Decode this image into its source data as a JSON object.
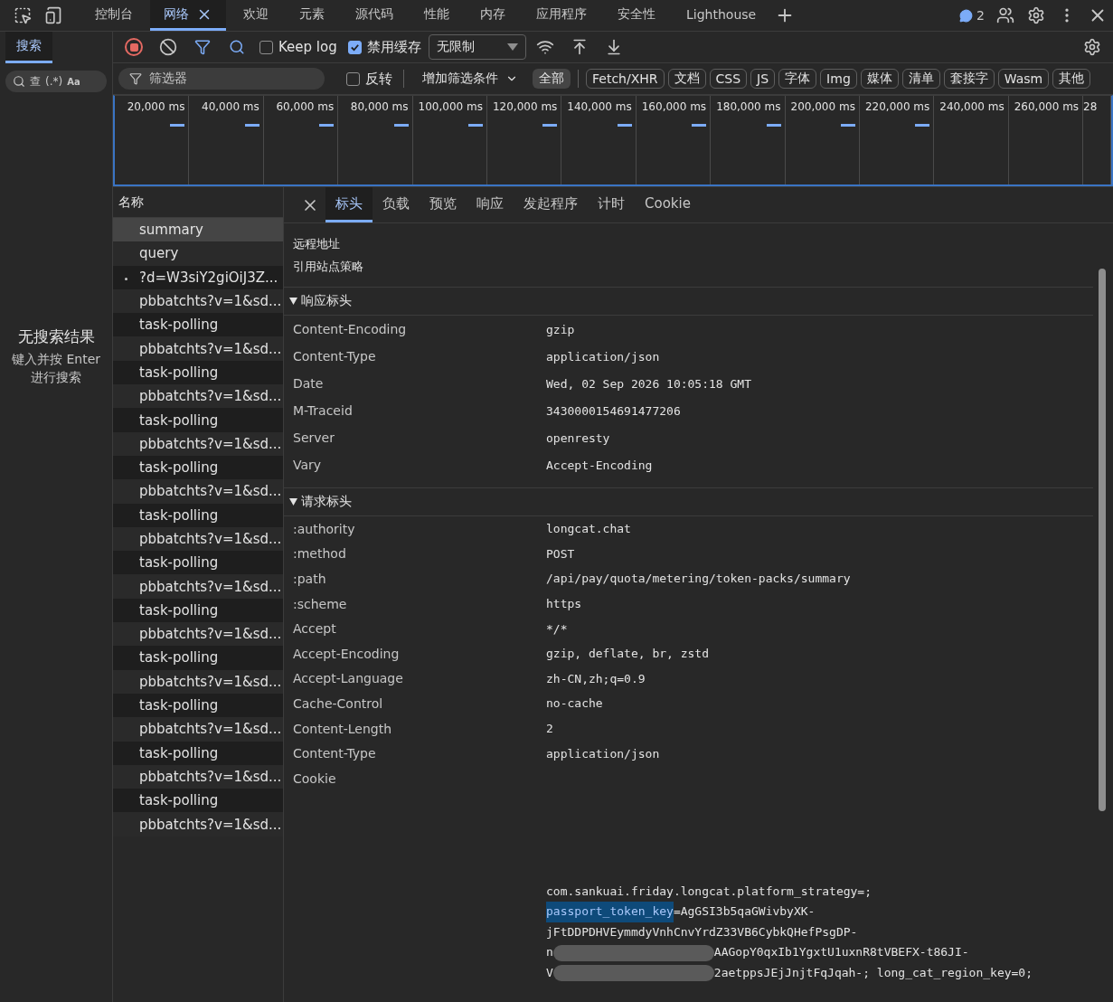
{
  "top_tabs": [
    {
      "label": "控制台",
      "selected": false,
      "closable": false
    },
    {
      "label": "网络",
      "selected": true,
      "closable": true
    },
    {
      "label": "欢迎",
      "selected": false,
      "closable": false
    },
    {
      "label": "元素",
      "selected": false,
      "closable": false
    },
    {
      "label": "源代码",
      "selected": false,
      "closable": false
    },
    {
      "label": "性能",
      "selected": false,
      "closable": false
    },
    {
      "label": "内存",
      "selected": false,
      "closable": false
    },
    {
      "label": "应用程序",
      "selected": false,
      "closable": false
    },
    {
      "label": "安全性",
      "selected": false,
      "closable": false
    },
    {
      "label": "Lighthouse",
      "selected": false,
      "closable": false
    }
  ],
  "issues_count": "2",
  "sidebar": {
    "tab": "搜索",
    "search_placeholder": "查",
    "regex_toggle": "(.*)",
    "case_toggle": "Aa",
    "empty_title": "无搜索结果",
    "empty_hint": "键入并按 Enter 进行搜索"
  },
  "toolbar": {
    "recording": true,
    "keep_log": {
      "label": "Keep log",
      "checked": false
    },
    "disable_cache": {
      "label": "禁用缓存",
      "checked": true
    },
    "throttle": "无限制"
  },
  "filter": {
    "placeholder": "筛选器",
    "invert": {
      "label": "反转",
      "checked": false
    },
    "more_filters": "增加筛选条件",
    "types": [
      {
        "label": "全部",
        "selected": true
      },
      {
        "label": "Fetch/XHR",
        "selected": false
      },
      {
        "label": "文档",
        "selected": false
      },
      {
        "label": "CSS",
        "selected": false
      },
      {
        "label": "JS",
        "selected": false
      },
      {
        "label": "字体",
        "selected": false
      },
      {
        "label": "Img",
        "selected": false
      },
      {
        "label": "媒体",
        "selected": false
      },
      {
        "label": "清单",
        "selected": false
      },
      {
        "label": "套接字",
        "selected": false
      },
      {
        "label": "Wasm",
        "selected": false
      },
      {
        "label": "其他",
        "selected": false
      }
    ]
  },
  "timeline": {
    "ticks": [
      "20,000 ms",
      "40,000 ms",
      "60,000 ms",
      "80,000 ms",
      "100,000 ms",
      "120,000 ms",
      "140,000 ms",
      "160,000 ms",
      "180,000 ms",
      "200,000 ms",
      "220,000 ms",
      "240,000 ms",
      "260,000 ms",
      "28"
    ]
  },
  "requests": {
    "column": "名称",
    "rows": [
      {
        "name": "summary",
        "selected": true,
        "kind": "plain"
      },
      {
        "name": "query",
        "selected": false,
        "kind": "plain"
      },
      {
        "name": "?d=W3siY2giOiJ3Z...",
        "selected": false,
        "kind": "dot"
      },
      {
        "name": "pbbatchts?v=1&sd...",
        "selected": false,
        "kind": "plain"
      },
      {
        "name": "task-polling",
        "selected": false,
        "kind": "plain"
      },
      {
        "name": "pbbatchts?v=1&sd...",
        "selected": false,
        "kind": "plain"
      },
      {
        "name": "task-polling",
        "selected": false,
        "kind": "plain"
      },
      {
        "name": "pbbatchts?v=1&sd...",
        "selected": false,
        "kind": "plain"
      },
      {
        "name": "task-polling",
        "selected": false,
        "kind": "plain"
      },
      {
        "name": "pbbatchts?v=1&sd...",
        "selected": false,
        "kind": "plain"
      },
      {
        "name": "task-polling",
        "selected": false,
        "kind": "plain"
      },
      {
        "name": "pbbatchts?v=1&sd...",
        "selected": false,
        "kind": "plain"
      },
      {
        "name": "task-polling",
        "selected": false,
        "kind": "plain"
      },
      {
        "name": "pbbatchts?v=1&sd...",
        "selected": false,
        "kind": "plain"
      },
      {
        "name": "task-polling",
        "selected": false,
        "kind": "plain"
      },
      {
        "name": "pbbatchts?v=1&sd...",
        "selected": false,
        "kind": "plain"
      },
      {
        "name": "task-polling",
        "selected": false,
        "kind": "plain"
      },
      {
        "name": "pbbatchts?v=1&sd...",
        "selected": false,
        "kind": "plain"
      },
      {
        "name": "task-polling",
        "selected": false,
        "kind": "plain"
      },
      {
        "name": "pbbatchts?v=1&sd...",
        "selected": false,
        "kind": "plain"
      },
      {
        "name": "task-polling",
        "selected": false,
        "kind": "plain"
      },
      {
        "name": "pbbatchts?v=1&sd...",
        "selected": false,
        "kind": "plain"
      },
      {
        "name": "task-polling",
        "selected": false,
        "kind": "plain"
      },
      {
        "name": "pbbatchts?v=1&sd...",
        "selected": false,
        "kind": "plain"
      },
      {
        "name": "task-polling",
        "selected": false,
        "kind": "plain"
      },
      {
        "name": "pbbatchts?v=1&sd...",
        "selected": false,
        "kind": "plain"
      }
    ]
  },
  "detail": {
    "tabs": [
      {
        "label": "标头",
        "selected": true
      },
      {
        "label": "负载",
        "selected": false
      },
      {
        "label": "预览",
        "selected": false
      },
      {
        "label": "响应",
        "selected": false
      },
      {
        "label": "发起程序",
        "selected": false
      },
      {
        "label": "计时",
        "selected": false
      },
      {
        "label": "Cookie",
        "selected": false
      }
    ],
    "general": [
      "远程地址",
      "引用站点策略"
    ],
    "sections": [
      {
        "title": "响应标头",
        "expanded": true,
        "headers": [
          {
            "name": "Content-Encoding",
            "value": "gzip"
          },
          {
            "name": "Content-Type",
            "value": "application/json"
          },
          {
            "name": "Date",
            "value": "Wed, 02 Sep 2026 10:05:18 GMT"
          },
          {
            "name": "M-Traceid",
            "value": "3430000154691477206"
          },
          {
            "name": "Server",
            "value": "openresty"
          },
          {
            "name": "Vary",
            "value": "Accept-Encoding"
          }
        ]
      },
      {
        "title": "请求标头",
        "expanded": true,
        "headers": [
          {
            "name": ":authority",
            "value": "longcat.chat"
          },
          {
            "name": ":method",
            "value": "POST"
          },
          {
            "name": ":path",
            "value": "/api/pay/quota/metering/token-packs/summary"
          },
          {
            "name": ":scheme",
            "value": "https"
          },
          {
            "name": "Accept",
            "value": "*/*"
          },
          {
            "name": "Accept-Encoding",
            "value": "gzip, deflate, br, zstd"
          },
          {
            "name": "Accept-Language",
            "value": "zh-CN,zh;q=0.9"
          },
          {
            "name": "Cache-Control",
            "value": "no-cache"
          },
          {
            "name": "Content-Length",
            "value": "2"
          },
          {
            "name": "Content-Type",
            "value": "application/json"
          }
        ]
      }
    ],
    "cookie": {
      "name": "Cookie",
      "lines": [
        [
          {
            "kind": "text",
            "text": "com.sankuai.friday.longcat.platform_strategy=;"
          }
        ],
        [
          {
            "kind": "highlight",
            "text": "passport_token_key"
          },
          {
            "kind": "text",
            "text": "=AgGSI3b5qaGWivbyXK-"
          }
        ],
        [
          {
            "kind": "text",
            "text": "jFtDDPDHVEymmdyVnhCnvYrdZ33VB6CybkQHefPsgDP-"
          }
        ],
        [
          {
            "kind": "text",
            "text": "n"
          },
          {
            "kind": "redacted"
          },
          {
            "kind": "text",
            "text": "AAGopY0qxIb1YgxtU1uxnR8tVBEFX-t86JI-"
          }
        ],
        [
          {
            "kind": "text",
            "text": "V"
          },
          {
            "kind": "redacted"
          },
          {
            "kind": "text",
            "text": "2aetppsJEjJnjtFqJqah-; long_cat_region_key=0;"
          }
        ]
      ]
    }
  }
}
